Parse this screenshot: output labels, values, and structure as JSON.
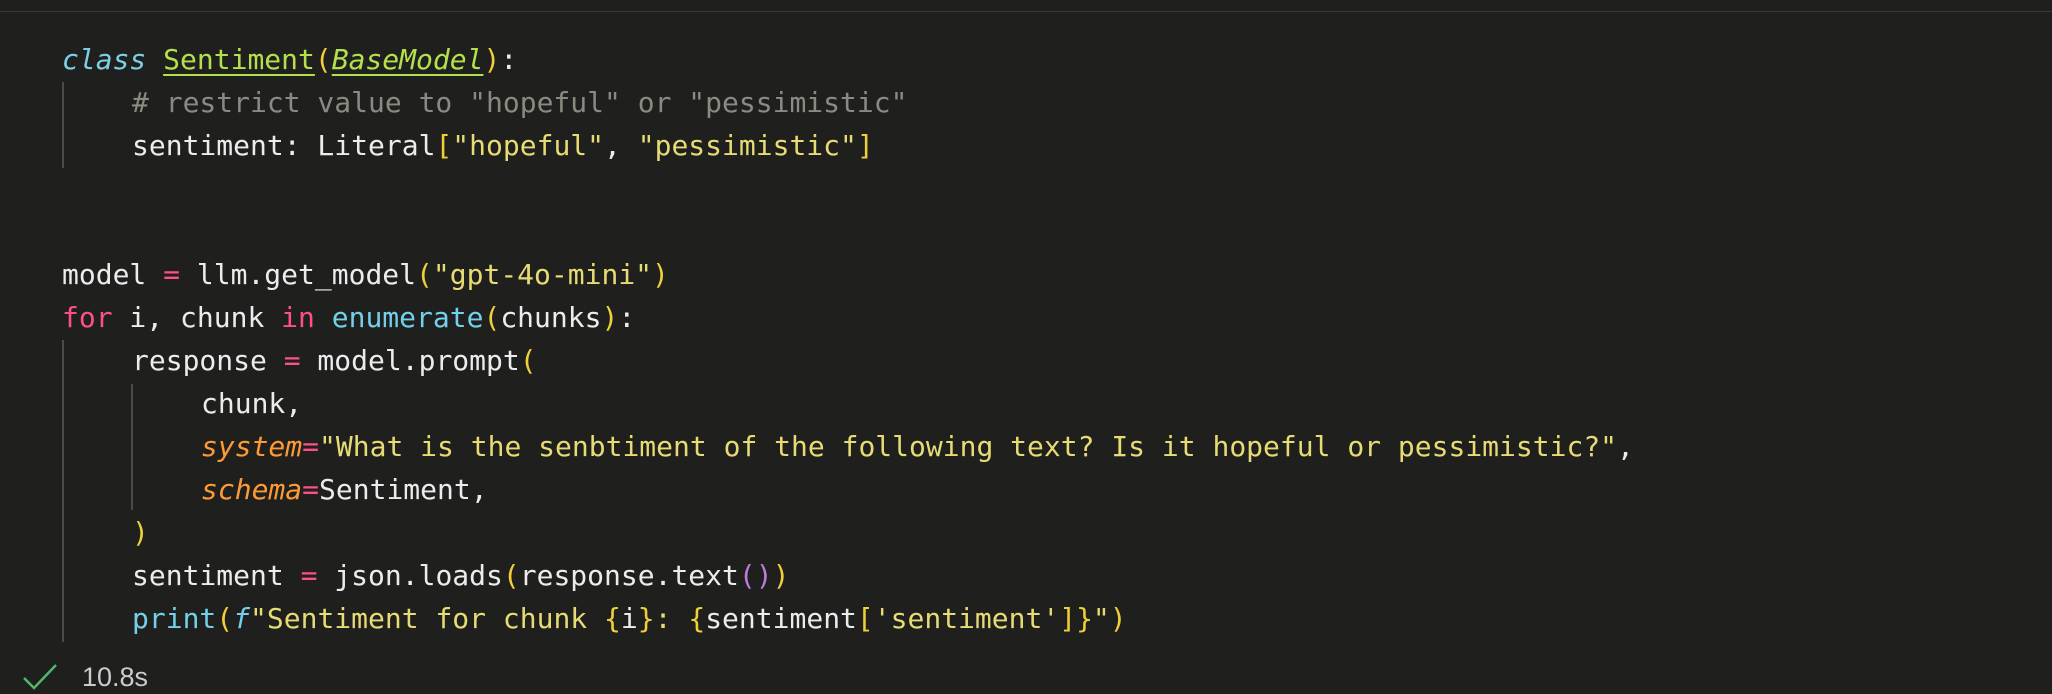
{
  "cell": {
    "lines": [
      {
        "indent": 0,
        "tokens": [
          {
            "t": "class",
            "c": "kw-class"
          },
          {
            "t": " ",
            "c": "plain"
          },
          {
            "t": "Sentiment",
            "c": "cls-name"
          },
          {
            "t": "(",
            "c": "punct-y"
          },
          {
            "t": "BaseModel",
            "c": "base-cls"
          },
          {
            "t": ")",
            "c": "punct-y"
          },
          {
            "t": ":",
            "c": "plain"
          }
        ]
      },
      {
        "indent": 1,
        "tokens": [
          {
            "t": "# restrict value to \"hopeful\" or \"pessimistic\"",
            "c": "comment"
          }
        ]
      },
      {
        "indent": 1,
        "tokens": [
          {
            "t": "sentiment: Literal",
            "c": "plain"
          },
          {
            "t": "[",
            "c": "punct-y"
          },
          {
            "t": "\"hopeful\"",
            "c": "str"
          },
          {
            "t": ", ",
            "c": "plain"
          },
          {
            "t": "\"pessimistic\"",
            "c": "str"
          },
          {
            "t": "]",
            "c": "punct-y"
          }
        ]
      },
      {
        "indent": 0,
        "tokens": []
      },
      {
        "indent": 0,
        "tokens": []
      },
      {
        "indent": 0,
        "tokens": [
          {
            "t": "model ",
            "c": "plain"
          },
          {
            "t": "=",
            "c": "op"
          },
          {
            "t": " llm.get_model",
            "c": "plain"
          },
          {
            "t": "(",
            "c": "punct-y"
          },
          {
            "t": "\"gpt-4o-mini\"",
            "c": "str"
          },
          {
            "t": ")",
            "c": "punct-y"
          }
        ]
      },
      {
        "indent": 0,
        "tokens": [
          {
            "t": "for",
            "c": "kw"
          },
          {
            "t": " i, chunk ",
            "c": "plain"
          },
          {
            "t": "in",
            "c": "kw"
          },
          {
            "t": " ",
            "c": "plain"
          },
          {
            "t": "enumerate",
            "c": "builtin"
          },
          {
            "t": "(",
            "c": "punct-y"
          },
          {
            "t": "chunks",
            "c": "plain"
          },
          {
            "t": ")",
            "c": "punct-y"
          },
          {
            "t": ":",
            "c": "plain"
          }
        ]
      },
      {
        "indent": 1,
        "tokens": [
          {
            "t": "response ",
            "c": "plain"
          },
          {
            "t": "=",
            "c": "op"
          },
          {
            "t": " model.prompt",
            "c": "plain"
          },
          {
            "t": "(",
            "c": "punct-y"
          }
        ]
      },
      {
        "indent": 2,
        "tokens": [
          {
            "t": "chunk,",
            "c": "plain"
          }
        ]
      },
      {
        "indent": 2,
        "tokens": [
          {
            "t": "system",
            "c": "param"
          },
          {
            "t": "=",
            "c": "op"
          },
          {
            "t": "\"What is the senbtiment of the following text? Is it hopeful or pessimistic?\"",
            "c": "str"
          },
          {
            "t": ",",
            "c": "plain"
          }
        ]
      },
      {
        "indent": 2,
        "tokens": [
          {
            "t": "schema",
            "c": "param"
          },
          {
            "t": "=",
            "c": "op"
          },
          {
            "t": "Sentiment,",
            "c": "plain"
          }
        ]
      },
      {
        "indent": 1,
        "tokens": [
          {
            "t": ")",
            "c": "punct-y"
          }
        ]
      },
      {
        "indent": 1,
        "tokens": [
          {
            "t": "sentiment ",
            "c": "plain"
          },
          {
            "t": "=",
            "c": "op"
          },
          {
            "t": " json.loads",
            "c": "plain"
          },
          {
            "t": "(",
            "c": "punct-y"
          },
          {
            "t": "response.text",
            "c": "plain"
          },
          {
            "t": "()",
            "c": "punct-m"
          },
          {
            "t": ")",
            "c": "punct-y"
          }
        ]
      },
      {
        "indent": 1,
        "tokens": [
          {
            "t": "print",
            "c": "builtin"
          },
          {
            "t": "(",
            "c": "punct-y"
          },
          {
            "t": "f",
            "c": "fpre"
          },
          {
            "t": "\"Sentiment for chunk ",
            "c": "str"
          },
          {
            "t": "{",
            "c": "punct-y"
          },
          {
            "t": "i",
            "c": "plain"
          },
          {
            "t": "}",
            "c": "punct-y"
          },
          {
            "t": ": ",
            "c": "str"
          },
          {
            "t": "{",
            "c": "punct-y"
          },
          {
            "t": "sentiment",
            "c": "plain"
          },
          {
            "t": "[",
            "c": "punct-y"
          },
          {
            "t": "'sentiment'",
            "c": "str"
          },
          {
            "t": "]",
            "c": "punct-y"
          },
          {
            "t": "}",
            "c": "punct-y"
          },
          {
            "t": "\"",
            "c": "str"
          },
          {
            "t": ")",
            "c": "punct-y"
          }
        ]
      }
    ]
  },
  "status": {
    "icon": "check-icon",
    "duration": "10.8s",
    "check_color": "#4fb86a"
  }
}
